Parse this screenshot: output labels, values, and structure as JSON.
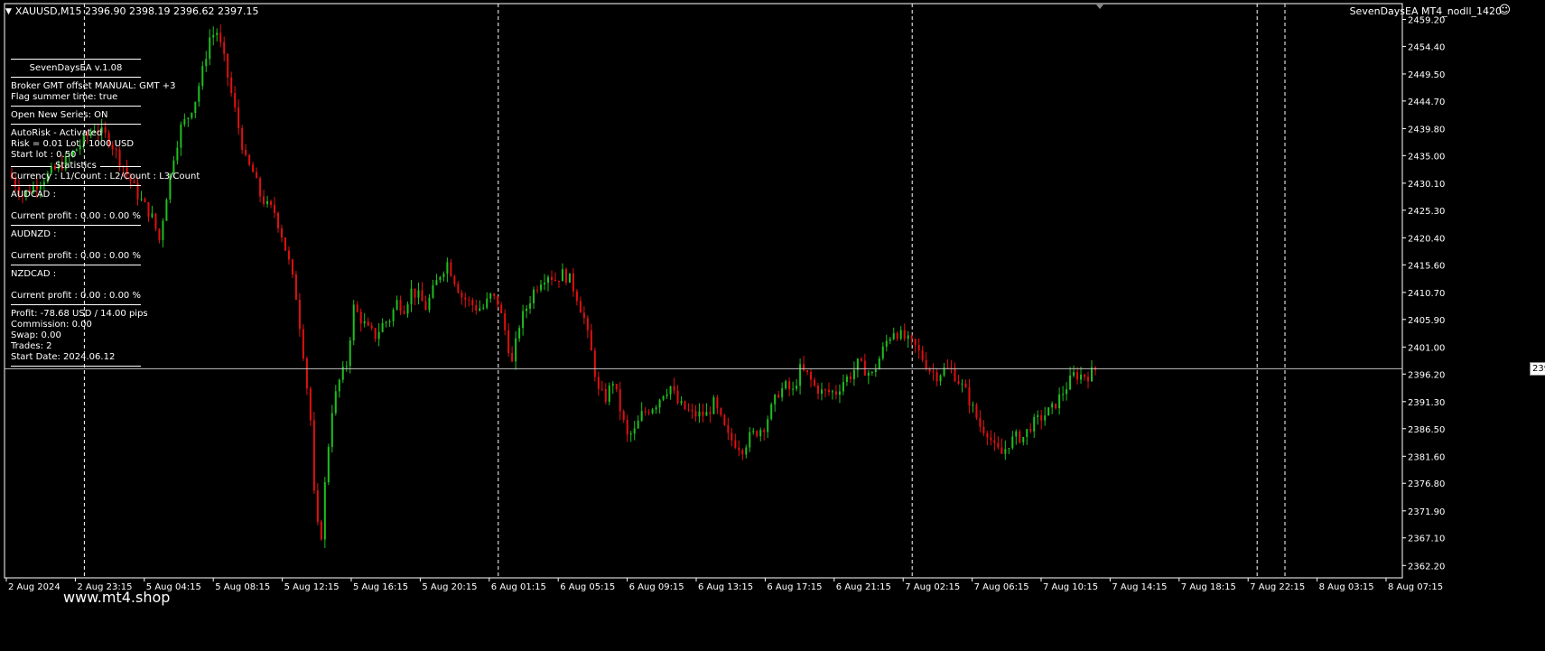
{
  "header": {
    "symbol_info": "XAUUSD,M15  2396.90 2398.19 2396.62 2397.15",
    "ea_label": "SevenDaysEA MT4_nodll_1420",
    "smiley": "☺"
  },
  "panel": {
    "title": "SevenDaysEA  v.1.08",
    "broker_gmt": "Broker GMT offset MANUAL:  GMT +3",
    "summer_flag": "Flag summer time: true",
    "open_new_series": "Open New Series: ON",
    "autorisk": "AutoRisk - Activated",
    "risk": "Risk = 0.01 Lot / 1000 USD",
    "start_lot": "Start lot : 0.50",
    "statistics_label": "Statistics",
    "stats_header": "Currency : L1/Count : L2/Count : L3/Count",
    "pairs": [
      {
        "name": "AUDCAD :",
        "profit": "Current profit : 0.00 : 0.00 %"
      },
      {
        "name": "AUDNZD :",
        "profit": "Current profit : 0.00 : 0.00 %"
      },
      {
        "name": "NZDCAD :",
        "profit": "Current profit : 0.00 : 0.00 %"
      }
    ],
    "profit": "Profit: -78.68 USD / 14.00 pips",
    "commission": "Commission: 0.00",
    "swap": "Swap: 0.00",
    "trades": "Trades: 2",
    "start_date": "Start Date: 2024.06.12"
  },
  "watermark": "www.mt4.shop",
  "current_price": "2397.15",
  "colors": {
    "bull": "#1fbf1f",
    "bear": "#e01010",
    "grid": "#ffffff",
    "bg": "#000000"
  },
  "chart_data": {
    "type": "candlestick",
    "ylim": [
      2360.0,
      2462.0
    ],
    "yticks": [
      "2459.20",
      "2454.40",
      "2449.50",
      "2444.70",
      "2439.80",
      "2435.00",
      "2430.10",
      "2425.30",
      "2420.40",
      "2415.60",
      "2410.70",
      "2405.90",
      "2401.00",
      "2396.20",
      "2391.30",
      "2386.50",
      "2381.60",
      "2376.80",
      "2371.90",
      "2367.10",
      "2362.20"
    ],
    "xticks": [
      "2 Aug 2024",
      "2 Aug 23:15",
      "5 Aug 04:15",
      "5 Aug 08:15",
      "5 Aug 12:15",
      "5 Aug 16:15",
      "5 Aug 20:15",
      "6 Aug 01:15",
      "6 Aug 05:15",
      "6 Aug 09:15",
      "6 Aug 13:15",
      "6 Aug 17:15",
      "6 Aug 21:15",
      "7 Aug 02:15",
      "7 Aug 06:15",
      "7 Aug 10:15",
      "7 Aug 14:15",
      "7 Aug 18:15",
      "7 Aug 22:15",
      "8 Aug 03:15",
      "8 Aug 07:15"
    ],
    "day_separators": [
      "2 Aug 23:15",
      "6 Aug 01:15",
      "7 Aug 02:15",
      "7 Aug 22:15"
    ],
    "close_path": [
      [
        0,
        2432
      ],
      [
        10,
        2428
      ],
      [
        20,
        2430
      ],
      [
        30,
        2432
      ],
      [
        40,
        2434
      ],
      [
        50,
        2437
      ],
      [
        60,
        2440
      ],
      [
        70,
        2438
      ],
      [
        80,
        2433
      ],
      [
        90,
        2428
      ],
      [
        100,
        2424
      ],
      [
        105,
        2420
      ],
      [
        110,
        2428
      ],
      [
        115,
        2435
      ],
      [
        120,
        2440
      ],
      [
        125,
        2442
      ],
      [
        130,
        2445
      ],
      [
        135,
        2450
      ],
      [
        140,
        2456
      ],
      [
        145,
        2457
      ],
      [
        150,
        2452
      ],
      [
        155,
        2446
      ],
      [
        160,
        2440
      ],
      [
        165,
        2434
      ],
      [
        170,
        2432
      ],
      [
        175,
        2428
      ],
      [
        180,
        2426
      ],
      [
        185,
        2425
      ],
      [
        190,
        2421
      ],
      [
        195,
        2416
      ],
      [
        200,
        2410
      ],
      [
        205,
        2400
      ],
      [
        210,
        2388
      ],
      [
        213,
        2372
      ],
      [
        217,
        2366
      ],
      [
        221,
        2380
      ],
      [
        225,
        2390
      ],
      [
        230,
        2395
      ],
      [
        235,
        2398
      ],
      [
        240,
        2408
      ],
      [
        245,
        2406
      ],
      [
        250,
        2404
      ],
      [
        255,
        2403
      ],
      [
        260,
        2405
      ],
      [
        265,
        2406
      ],
      [
        270,
        2409
      ],
      [
        275,
        2408
      ],
      [
        280,
        2411
      ],
      [
        285,
        2410
      ],
      [
        290,
        2408
      ],
      [
        295,
        2411
      ],
      [
        300,
        2414
      ],
      [
        305,
        2416
      ],
      [
        310,
        2413
      ],
      [
        315,
        2410
      ],
      [
        320,
        2409
      ],
      [
        325,
        2408
      ],
      [
        330,
        2408
      ],
      [
        335,
        2410
      ],
      [
        340,
        2409
      ],
      [
        345,
        2404
      ],
      [
        350,
        2398
      ],
      [
        355,
        2405
      ],
      [
        360,
        2408
      ],
      [
        365,
        2411
      ],
      [
        370,
        2413
      ],
      [
        375,
        2414
      ],
      [
        380,
        2413
      ],
      [
        385,
        2414
      ],
      [
        390,
        2413
      ],
      [
        395,
        2410
      ],
      [
        400,
        2406
      ],
      [
        405,
        2400
      ],
      [
        410,
        2393
      ],
      [
        415,
        2392
      ],
      [
        420,
        2395
      ],
      [
        425,
        2390
      ],
      [
        430,
        2385
      ],
      [
        435,
        2386
      ],
      [
        440,
        2389
      ],
      [
        445,
        2390
      ],
      [
        450,
        2391
      ],
      [
        455,
        2393
      ],
      [
        460,
        2394
      ],
      [
        465,
        2391
      ],
      [
        470,
        2390
      ],
      [
        475,
        2389
      ],
      [
        480,
        2389
      ],
      [
        485,
        2389
      ],
      [
        490,
        2391
      ],
      [
        495,
        2388
      ],
      [
        500,
        2385
      ],
      [
        505,
        2384
      ],
      [
        510,
        2383
      ],
      [
        515,
        2385
      ],
      [
        520,
        2386
      ],
      [
        525,
        2387
      ],
      [
        530,
        2390
      ],
      [
        535,
        2393
      ],
      [
        540,
        2394
      ],
      [
        545,
        2393
      ],
      [
        550,
        2397
      ],
      [
        555,
        2396
      ],
      [
        560,
        2394
      ],
      [
        565,
        2393
      ],
      [
        570,
        2393
      ],
      [
        575,
        2393
      ],
      [
        580,
        2395
      ],
      [
        585,
        2396
      ],
      [
        590,
        2398
      ],
      [
        595,
        2397
      ],
      [
        600,
        2396
      ],
      [
        605,
        2399
      ],
      [
        610,
        2402
      ],
      [
        615,
        2404
      ],
      [
        620,
        2403
      ],
      [
        625,
        2402
      ],
      [
        630,
        2401
      ],
      [
        635,
        2399
      ],
      [
        640,
        2397
      ],
      [
        645,
        2396
      ],
      [
        650,
        2397
      ],
      [
        655,
        2397
      ],
      [
        660,
        2395
      ],
      [
        665,
        2393
      ],
      [
        670,
        2390
      ],
      [
        675,
        2387
      ],
      [
        680,
        2386
      ],
      [
        685,
        2383
      ],
      [
        690,
        2382
      ],
      [
        695,
        2384
      ],
      [
        700,
        2385
      ],
      [
        705,
        2385
      ],
      [
        710,
        2387
      ],
      [
        715,
        2388
      ],
      [
        720,
        2389
      ],
      [
        725,
        2390
      ],
      [
        730,
        2392
      ],
      [
        735,
        2394
      ],
      [
        740,
        2396
      ],
      [
        745,
        2396
      ],
      [
        750,
        2396
      ],
      [
        755,
        2397
      ]
    ]
  }
}
